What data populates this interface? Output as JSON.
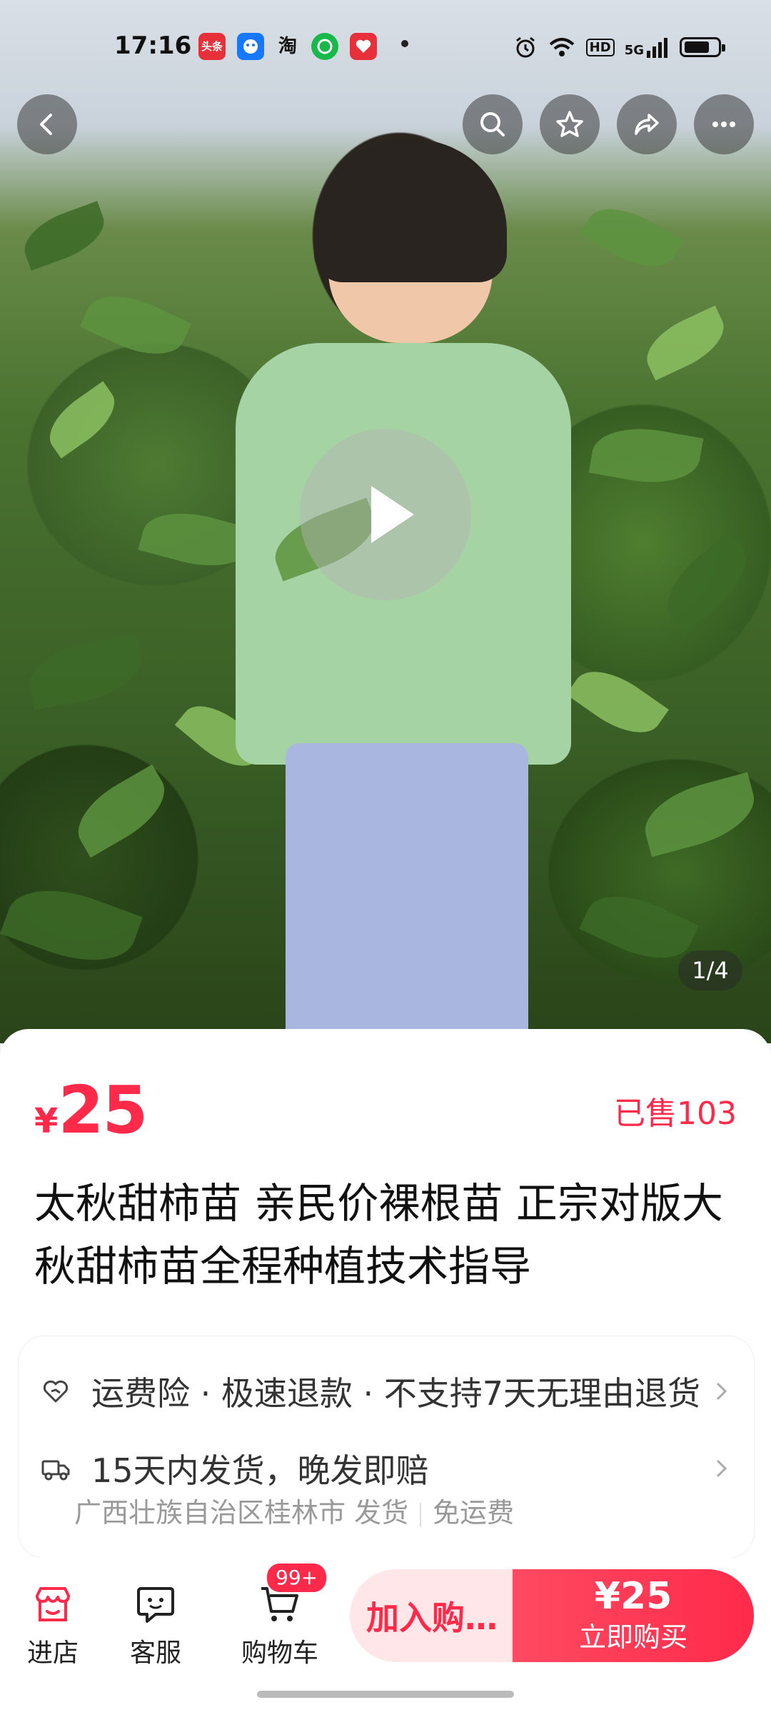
{
  "status_bar": {
    "time": "17:16",
    "apps": [
      {
        "name": "头条",
        "color": "#e8303a"
      },
      {
        "name": "",
        "color": "#1677ff"
      },
      {
        "name": "淘",
        "color": "transparent"
      },
      {
        "name": "",
        "color": "#19b84b"
      },
      {
        "name": "",
        "color": "#e8303a"
      }
    ],
    "network": "5G",
    "hd": "HD"
  },
  "gallery": {
    "counter": "1/4"
  },
  "product": {
    "currency": "¥",
    "price": "25",
    "sold": "已售103",
    "title": "太秋甜柿苗 亲民价裸根苗 正宗对版大秋甜柿苗全程种植技术指导"
  },
  "services": {
    "guarantee": "运费险 · 极速退款 · 不支持7天无理由退货",
    "shipping": "15天内发货，晚发即赔",
    "origin": "广西壮族自治区桂林市 发货",
    "freight": "免运费"
  },
  "bottom_bar": {
    "store": "进店",
    "service": "客服",
    "cart": "购物车",
    "cart_badge": "99+",
    "add_to_cart": "加入购…",
    "buy_price": "¥25",
    "buy_now": "立即购买"
  },
  "colors": {
    "accent": "#ff2a4a",
    "accent_light": "#ffe6e9"
  }
}
